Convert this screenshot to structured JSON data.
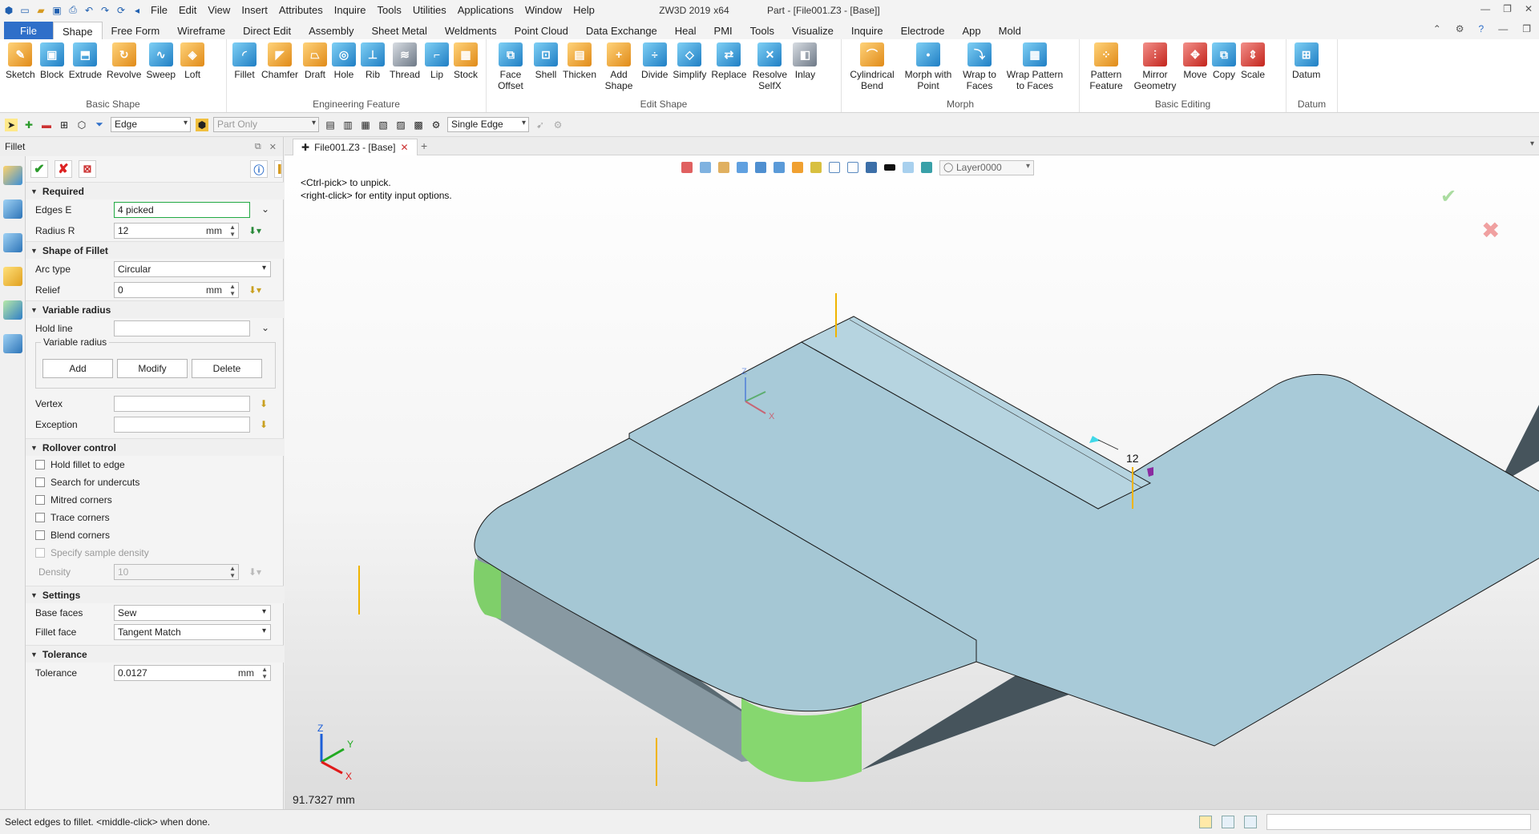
{
  "window": {
    "title_app": "ZW3D 2019",
    "title_arch": "x64",
    "title_doc": "Part - [File001.Z3 - [Base]]"
  },
  "menu": [
    "File",
    "Edit",
    "View",
    "Insert",
    "Attributes",
    "Inquire",
    "Tools",
    "Utilities",
    "Applications",
    "Window",
    "Help"
  ],
  "ribbon_tabs": [
    "File",
    "Shape",
    "Free Form",
    "Wireframe",
    "Direct Edit",
    "Assembly",
    "Sheet Metal",
    "Weldments",
    "Point Cloud",
    "Data Exchange",
    "Heal",
    "PMI",
    "Tools",
    "Visualize",
    "Inquire",
    "Electrode",
    "App",
    "Mold"
  ],
  "ribbon": {
    "basic_shape": {
      "title": "Basic Shape",
      "items": [
        "Sketch",
        "Block",
        "Extrude",
        "Revolve",
        "Sweep",
        "Loft"
      ]
    },
    "engineering": {
      "title": "Engineering Feature",
      "items": [
        "Fillet",
        "Chamfer",
        "Draft",
        "Hole",
        "Rib",
        "Thread",
        "Lip",
        "Stock"
      ]
    },
    "edit_shape": {
      "title": "Edit Shape",
      "items": [
        "Face Offset",
        "Shell",
        "Thicken",
        "Add Shape",
        "Divide",
        "Simplify",
        "Replace",
        "Resolve SelfX",
        "Inlay"
      ]
    },
    "morph": {
      "title": "Morph",
      "items": [
        "Cylindrical Bend",
        "Morph with Point",
        "Wrap to Faces",
        "Wrap Pattern to Faces"
      ]
    },
    "basic_editing": {
      "title": "Basic Editing",
      "items": [
        "Pattern Feature",
        "Mirror Geometry",
        "Move",
        "Copy",
        "Scale"
      ]
    },
    "datum": {
      "title": "Datum",
      "items": [
        "Datum"
      ]
    }
  },
  "toolbar2": {
    "filter": "Edge",
    "scope": "Part Only",
    "pick_mode": "Single Edge"
  },
  "panel": {
    "title": "Fillet",
    "required": {
      "title": "Required",
      "edges_label": "Edges E",
      "edges_value": "4 picked",
      "radius_label": "Radius R",
      "radius_value": "12",
      "unit": "mm"
    },
    "shape": {
      "title": "Shape of Fillet",
      "arc_label": "Arc type",
      "arc_value": "Circular",
      "relief_label": "Relief",
      "relief_value": "0",
      "unit": "mm"
    },
    "variable": {
      "title": "Variable radius",
      "hold_label": "Hold line",
      "group_label": "Variable radius",
      "add": "Add",
      "modify": "Modify",
      "delete": "Delete",
      "vertex_label": "Vertex",
      "exception_label": "Exception"
    },
    "rollover": {
      "title": "Rollover control",
      "items": [
        "Hold fillet to edge",
        "Search for undercuts",
        "Mitred corners",
        "Trace corners",
        "Blend corners",
        "Specify sample density"
      ],
      "density_label": "Density",
      "density_value": "10"
    },
    "settings": {
      "title": "Settings",
      "base_label": "Base faces",
      "base_value": "Sew",
      "fillet_label": "Fillet face",
      "fillet_value": "Tangent Match"
    },
    "tolerance": {
      "title": "Tolerance",
      "label": "Tolerance",
      "value": "0.0127",
      "unit": "mm"
    }
  },
  "view": {
    "tab_label": "File001.Z3 - [Base]",
    "layer": "Layer0000",
    "hint_line1": "<Ctrl-pick> to unpick.",
    "hint_line2": "<right-click> for entity input options.",
    "dim_label": "12",
    "coord_readout": "91.7327 mm",
    "axes": {
      "z": "Z",
      "y": "Y",
      "x": "X"
    }
  },
  "status": {
    "message": "Select edges to fillet.  <middle-click> when done."
  },
  "colors": {
    "accent": "#2f6fc9",
    "model_top": "#a4c6d3",
    "model_side": "#47555e",
    "fillet": "#7fcf6a",
    "dim_marker": "#f0b400"
  }
}
